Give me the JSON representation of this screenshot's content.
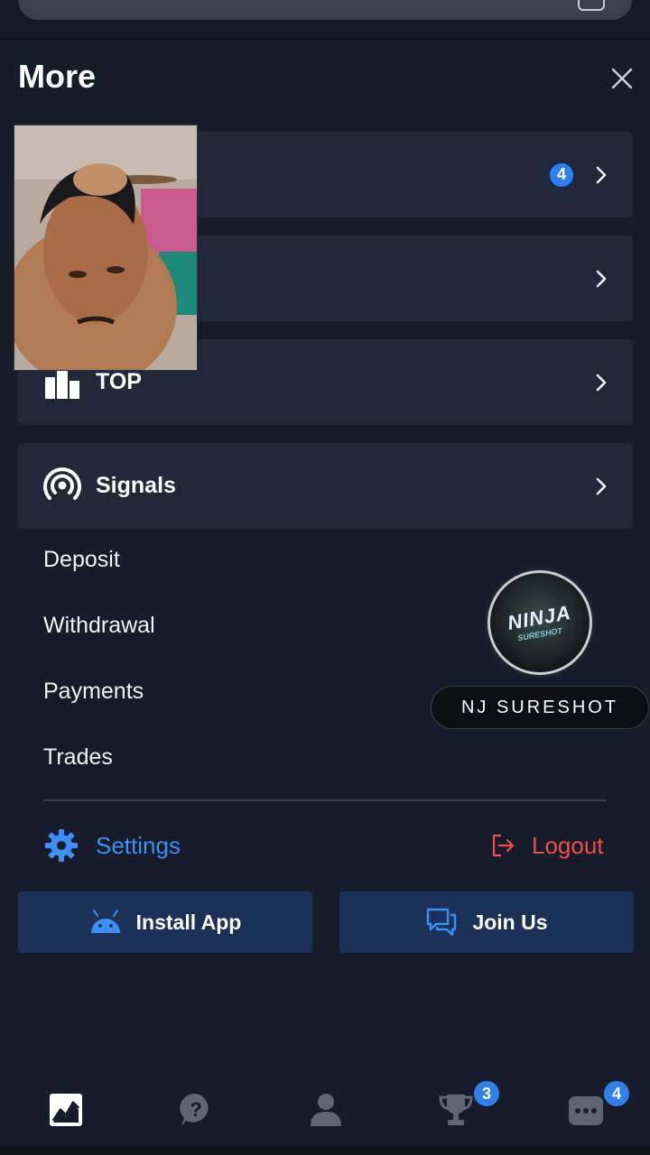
{
  "header": {
    "title": "More"
  },
  "menu_cards": [
    {
      "label": "",
      "badge": "4"
    },
    {
      "label": "",
      "badge": ""
    },
    {
      "label": "TOP",
      "badge": ""
    },
    {
      "label": "Signals",
      "badge": ""
    }
  ],
  "links": [
    "Deposit",
    "Withdrawal",
    "Payments",
    "Trades"
  ],
  "settings": {
    "label": "Settings"
  },
  "logout": {
    "label": "Logout"
  },
  "actions": {
    "install": "Install App",
    "join": "Join Us"
  },
  "overlay": {
    "logo_text": "NINJA",
    "logo_sub": "SURESHOT",
    "name": "NJ SURESHOT"
  },
  "bottom_nav": {
    "trophy_badge": "3",
    "more_badge": "4"
  },
  "colors": {
    "accent": "#3c8ff5",
    "logout": "#f24d4d",
    "badge": "#2f80ed",
    "card": "#232838",
    "button": "#1b3158"
  },
  "icons": [
    "close-icon",
    "chevron-right-icon",
    "podium-icon",
    "signal-icon",
    "gear-icon",
    "logout-icon",
    "android-icon",
    "chat-icon",
    "chart-icon",
    "help-icon",
    "user-icon",
    "trophy-icon",
    "more-icon"
  ]
}
